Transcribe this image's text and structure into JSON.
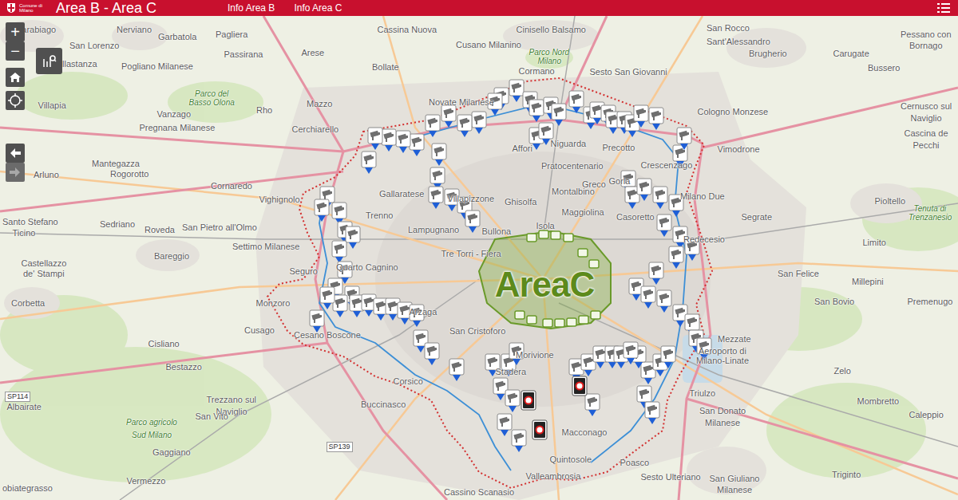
{
  "header": {
    "logo_lines": [
      "Comune di",
      "Milano"
    ],
    "title": "Area B - Area C",
    "links": [
      {
        "label": "Info Area B"
      },
      {
        "label": "Info Area C"
      }
    ]
  },
  "controls": {
    "zoom_in": "+",
    "zoom_out": "−",
    "history": [
      {
        "kind": "back",
        "disabled": false
      },
      {
        "kind": "forward",
        "disabled": true
      }
    ]
  },
  "map": {
    "area_c_logo": "AreaC",
    "labels": [
      {
        "text": "Parabiago",
        "kind": "place"
      },
      {
        "text": "Nerviano",
        "kind": "place"
      },
      {
        "text": "Garbatola",
        "kind": "place"
      },
      {
        "text": "Pagliera",
        "kind": "place"
      },
      {
        "text": "Cassina Nuova",
        "kind": "place"
      },
      {
        "text": "Cinisello Balsamo",
        "kind": "place"
      },
      {
        "text": "San Rocco",
        "kind": "place"
      },
      {
        "text": "Pessano con",
        "kind": "place"
      },
      {
        "text": "Bornago",
        "kind": "place"
      },
      {
        "text": "San Lorenzo",
        "kind": "place"
      },
      {
        "text": "Passirana",
        "kind": "place"
      },
      {
        "text": "Arese",
        "kind": "place"
      },
      {
        "text": "Cusano Milanino",
        "kind": "place"
      },
      {
        "text": "Sant'Alessandro",
        "kind": "place"
      },
      {
        "text": "Brugherio",
        "kind": "place"
      },
      {
        "text": "Carugate",
        "kind": "place"
      },
      {
        "text": "Villastanza",
        "kind": "place"
      },
      {
        "text": "Pogliano Milanese",
        "kind": "place"
      },
      {
        "text": "Bollate",
        "kind": "place"
      },
      {
        "text": "Parco Nord",
        "kind": "park"
      },
      {
        "text": "Milano",
        "kind": "park"
      },
      {
        "text": "Cormano",
        "kind": "place"
      },
      {
        "text": "Sesto San Giovanni",
        "kind": "place"
      },
      {
        "text": "Bussero",
        "kind": "place"
      },
      {
        "text": "Parco del",
        "kind": "park"
      },
      {
        "text": "Basso Olona",
        "kind": "park"
      },
      {
        "text": "Villapia",
        "kind": "place"
      },
      {
        "text": "Vanzago",
        "kind": "place"
      },
      {
        "text": "Rho",
        "kind": "place"
      },
      {
        "text": "Mazzo",
        "kind": "place"
      },
      {
        "text": "Novate Milanese",
        "kind": "place"
      },
      {
        "text": "Cologno Monzese",
        "kind": "place"
      },
      {
        "text": "Cernusco sul",
        "kind": "place"
      },
      {
        "text": "Naviglio",
        "kind": "place"
      },
      {
        "text": "Pregnana Milanese",
        "kind": "place"
      },
      {
        "text": "Cerchiarello",
        "kind": "place"
      },
      {
        "text": "Cascina de",
        "kind": "place"
      },
      {
        "text": "Pecchi",
        "kind": "place"
      },
      {
        "text": "Vimodrone",
        "kind": "place"
      },
      {
        "text": "Mantegazza",
        "kind": "place"
      },
      {
        "text": "Rogorotto",
        "kind": "place"
      },
      {
        "text": "Arluno",
        "kind": "place"
      },
      {
        "text": "Cornaredo",
        "kind": "place"
      },
      {
        "text": "Affori",
        "kind": "place"
      },
      {
        "text": "Niguarda",
        "kind": "place"
      },
      {
        "text": "Precotto",
        "kind": "place"
      },
      {
        "text": "Pratocentenario",
        "kind": "place"
      },
      {
        "text": "Crescenzago",
        "kind": "place"
      },
      {
        "text": "Gallaratese",
        "kind": "place"
      },
      {
        "text": "Villapizzone",
        "kind": "place"
      },
      {
        "text": "Ghisolfa",
        "kind": "place"
      },
      {
        "text": "Montalbino",
        "kind": "place"
      },
      {
        "text": "Greco",
        "kind": "place"
      },
      {
        "text": "Gorla",
        "kind": "place"
      },
      {
        "text": "Vighignolo",
        "kind": "place"
      },
      {
        "text": "Santo Stefano",
        "kind": "place"
      },
      {
        "text": "Ticino",
        "kind": "place"
      },
      {
        "text": "Sedriano",
        "kind": "place"
      },
      {
        "text": "San Pietro all'Olmo",
        "kind": "place"
      },
      {
        "text": "Trenno",
        "kind": "place"
      },
      {
        "text": "Maggiolina",
        "kind": "place"
      },
      {
        "text": "Casoretto",
        "kind": "place"
      },
      {
        "text": "Milano Due",
        "kind": "place"
      },
      {
        "text": "Segrate",
        "kind": "place"
      },
      {
        "text": "Pioltello",
        "kind": "place"
      },
      {
        "text": "Tenuta di",
        "kind": "park"
      },
      {
        "text": "Trenzanesio",
        "kind": "park"
      },
      {
        "text": "Lampugnano",
        "kind": "place"
      },
      {
        "text": "Bullona",
        "kind": "place"
      },
      {
        "text": "Isola",
        "kind": "place"
      },
      {
        "text": "Roveda",
        "kind": "place"
      },
      {
        "text": "Bareggio",
        "kind": "place"
      },
      {
        "text": "Settimo Milanese",
        "kind": "place"
      },
      {
        "text": "Quarto Cagnino",
        "kind": "place"
      },
      {
        "text": "Tre Torri - Fiera",
        "kind": "place"
      },
      {
        "text": "Redecesio",
        "kind": "place"
      },
      {
        "text": "Limito",
        "kind": "place"
      },
      {
        "text": "San Felice",
        "kind": "place"
      },
      {
        "text": "Millepini",
        "kind": "place"
      },
      {
        "text": "Castellazzo",
        "kind": "place"
      },
      {
        "text": "de' Stampi",
        "kind": "place"
      },
      {
        "text": "Seguro",
        "kind": "place"
      },
      {
        "text": "Corbetta",
        "kind": "place"
      },
      {
        "text": "Monzoro",
        "kind": "place"
      },
      {
        "text": "Cusago",
        "kind": "place"
      },
      {
        "text": "Cesano Boscone",
        "kind": "place"
      },
      {
        "text": "Arzaga",
        "kind": "place"
      },
      {
        "text": "San Cristoforo",
        "kind": "place"
      },
      {
        "text": "Premenugo",
        "kind": "place"
      },
      {
        "text": "San Bovio",
        "kind": "place"
      },
      {
        "text": "Cisliano",
        "kind": "place"
      },
      {
        "text": "Morivione",
        "kind": "place"
      },
      {
        "text": "Mezzate",
        "kind": "place"
      },
      {
        "text": "Aeroporto di",
        "kind": "place"
      },
      {
        "text": "Milano-Linate",
        "kind": "place"
      },
      {
        "text": "Zelo",
        "kind": "place"
      },
      {
        "text": "Corsico",
        "kind": "place"
      },
      {
        "text": "Stadera",
        "kind": "place"
      },
      {
        "text": "Triulzo",
        "kind": "place"
      },
      {
        "text": "Mombretto",
        "kind": "place"
      },
      {
        "text": "Caleppio",
        "kind": "place"
      },
      {
        "text": "Albairate",
        "kind": "place"
      },
      {
        "text": "Bestazzo",
        "kind": "place"
      },
      {
        "text": "SP114",
        "kind": "road"
      },
      {
        "text": "Trezzano sul",
        "kind": "place"
      },
      {
        "text": "Naviglio",
        "kind": "place"
      },
      {
        "text": "Buccinasco",
        "kind": "place"
      },
      {
        "text": "San Donato",
        "kind": "place"
      },
      {
        "text": "Milanese",
        "kind": "place"
      },
      {
        "text": "Parco agricolo",
        "kind": "park"
      },
      {
        "text": "Sud Milano",
        "kind": "park"
      },
      {
        "text": "San Vito",
        "kind": "place"
      },
      {
        "text": "Macconago",
        "kind": "place"
      },
      {
        "text": "Gaggiano",
        "kind": "place"
      },
      {
        "text": "Quintosole",
        "kind": "place"
      },
      {
        "text": "Poasco",
        "kind": "place"
      },
      {
        "text": "SP139",
        "kind": "road"
      },
      {
        "text": "Vermezzo",
        "kind": "place"
      },
      {
        "text": "Valleambrosia",
        "kind": "place"
      },
      {
        "text": "Sesto Ulteriano",
        "kind": "place"
      },
      {
        "text": "San Giuliano",
        "kind": "place"
      },
      {
        "text": "Milanese",
        "kind": "place"
      },
      {
        "text": "Triginto",
        "kind": "place"
      },
      {
        "text": "obiategrasso",
        "kind": "place"
      },
      {
        "text": "Cassino Scanasio",
        "kind": "place"
      }
    ],
    "pins": [
      {
        "kind": "camera"
      },
      {
        "kind": "camera"
      },
      {
        "kind": "camera"
      },
      {
        "kind": "camera"
      },
      {
        "kind": "camera"
      },
      {
        "kind": "camera"
      },
      {
        "kind": "camera"
      },
      {
        "kind": "camera"
      },
      {
        "kind": "camera"
      },
      {
        "kind": "camera"
      },
      {
        "kind": "camera"
      },
      {
        "kind": "camera"
      },
      {
        "kind": "camera"
      },
      {
        "kind": "camera"
      },
      {
        "kind": "camera"
      },
      {
        "kind": "camera"
      },
      {
        "kind": "camera"
      },
      {
        "kind": "camera"
      },
      {
        "kind": "camera"
      },
      {
        "kind": "camera"
      },
      {
        "kind": "camera"
      },
      {
        "kind": "camera"
      },
      {
        "kind": "camera"
      },
      {
        "kind": "camera"
      },
      {
        "kind": "camera"
      },
      {
        "kind": "camera"
      },
      {
        "kind": "camera"
      },
      {
        "kind": "camera"
      },
      {
        "kind": "camera"
      },
      {
        "kind": "camera"
      },
      {
        "kind": "camera"
      },
      {
        "kind": "camera"
      },
      {
        "kind": "camera"
      },
      {
        "kind": "camera"
      },
      {
        "kind": "camera"
      },
      {
        "kind": "camera"
      },
      {
        "kind": "camera"
      },
      {
        "kind": "camera"
      },
      {
        "kind": "camera"
      },
      {
        "kind": "camera"
      },
      {
        "kind": "camera"
      },
      {
        "kind": "camera"
      },
      {
        "kind": "camera"
      },
      {
        "kind": "camera"
      },
      {
        "kind": "camera"
      },
      {
        "kind": "camera"
      },
      {
        "kind": "camera"
      },
      {
        "kind": "camera"
      },
      {
        "kind": "camera"
      },
      {
        "kind": "camera"
      },
      {
        "kind": "camera"
      },
      {
        "kind": "camera"
      },
      {
        "kind": "camera"
      },
      {
        "kind": "camera"
      },
      {
        "kind": "camera"
      },
      {
        "kind": "camera"
      },
      {
        "kind": "camera"
      },
      {
        "kind": "camera"
      },
      {
        "kind": "camera"
      },
      {
        "kind": "camera"
      },
      {
        "kind": "camera"
      },
      {
        "kind": "camera"
      },
      {
        "kind": "camera"
      },
      {
        "kind": "camera"
      },
      {
        "kind": "camera"
      },
      {
        "kind": "camera"
      },
      {
        "kind": "camera"
      },
      {
        "kind": "camera"
      },
      {
        "kind": "camera"
      },
      {
        "kind": "camera"
      },
      {
        "kind": "camera"
      },
      {
        "kind": "camera"
      },
      {
        "kind": "camera"
      },
      {
        "kind": "camera"
      },
      {
        "kind": "camera"
      },
      {
        "kind": "camera"
      },
      {
        "kind": "camera"
      },
      {
        "kind": "camera"
      },
      {
        "kind": "camera"
      },
      {
        "kind": "camera"
      },
      {
        "kind": "camera"
      },
      {
        "kind": "camera"
      },
      {
        "kind": "camera"
      },
      {
        "kind": "camera"
      },
      {
        "kind": "camera"
      },
      {
        "kind": "camera"
      },
      {
        "kind": "camera"
      },
      {
        "kind": "camera"
      },
      {
        "kind": "camera"
      },
      {
        "kind": "camera"
      },
      {
        "kind": "camera"
      },
      {
        "kind": "camera"
      },
      {
        "kind": "camera"
      },
      {
        "kind": "gate"
      },
      {
        "kind": "gate"
      },
      {
        "kind": "gate"
      }
    ]
  }
}
